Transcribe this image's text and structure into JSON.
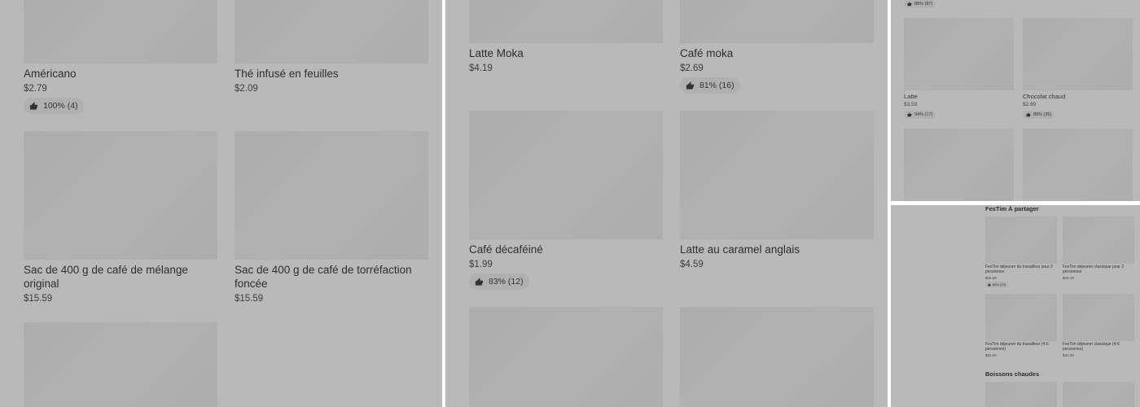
{
  "panel1": {
    "items": [
      {
        "name": "Américano",
        "price": "$2.79",
        "rating": "100% (4)"
      },
      {
        "name": "Thé infusé en feuilles",
        "price": "$2.09"
      },
      {
        "name": "Sac de 400 g de café de mélange original",
        "price": "$15.59"
      },
      {
        "name": "Sac de 400 g de café de torréfaction foncée",
        "price": "$15.59"
      }
    ]
  },
  "panel2": {
    "items": [
      {
        "name": "Latte Moka",
        "price": "$4.19"
      },
      {
        "name": "Café moka",
        "price": "$2.69",
        "rating": "81% (16)"
      },
      {
        "name": "Café décaféiné",
        "price": "$1.99",
        "rating": "83% (12)"
      },
      {
        "name": "Latte au caramel anglais",
        "price": "$4.59"
      }
    ]
  },
  "panel3": {
    "top_rating": "88% (87)",
    "items": [
      {
        "name": "Latte",
        "price": "$3.59",
        "rating": "94% (17)"
      },
      {
        "name": "Chocolat chaud",
        "price": "$2.69",
        "rating": "88% (35)"
      }
    ]
  },
  "panel4": {
    "section1": "FesTim À partager",
    "items": [
      {
        "name": "FesTim déjeuner du travailleur pour 2 personnes",
        "price": "$25.69",
        "rating": "86% (22)"
      },
      {
        "name": "FesTim déjeuner classique pour 2 personnes",
        "price": "$20.19"
      },
      {
        "name": "FesTim déjeuner du travailleur (4-6 personnes)",
        "price": "$52.59"
      },
      {
        "name": "FesTim déjeuner classique (4-6 personnes)",
        "price": "$42.29"
      }
    ],
    "section2": "Boissons chaudes"
  },
  "icons": {
    "rating": "thumbs-up-icon"
  },
  "colors": {
    "overlay": "#b9b9b9",
    "image_placeholder": "#adadad"
  }
}
